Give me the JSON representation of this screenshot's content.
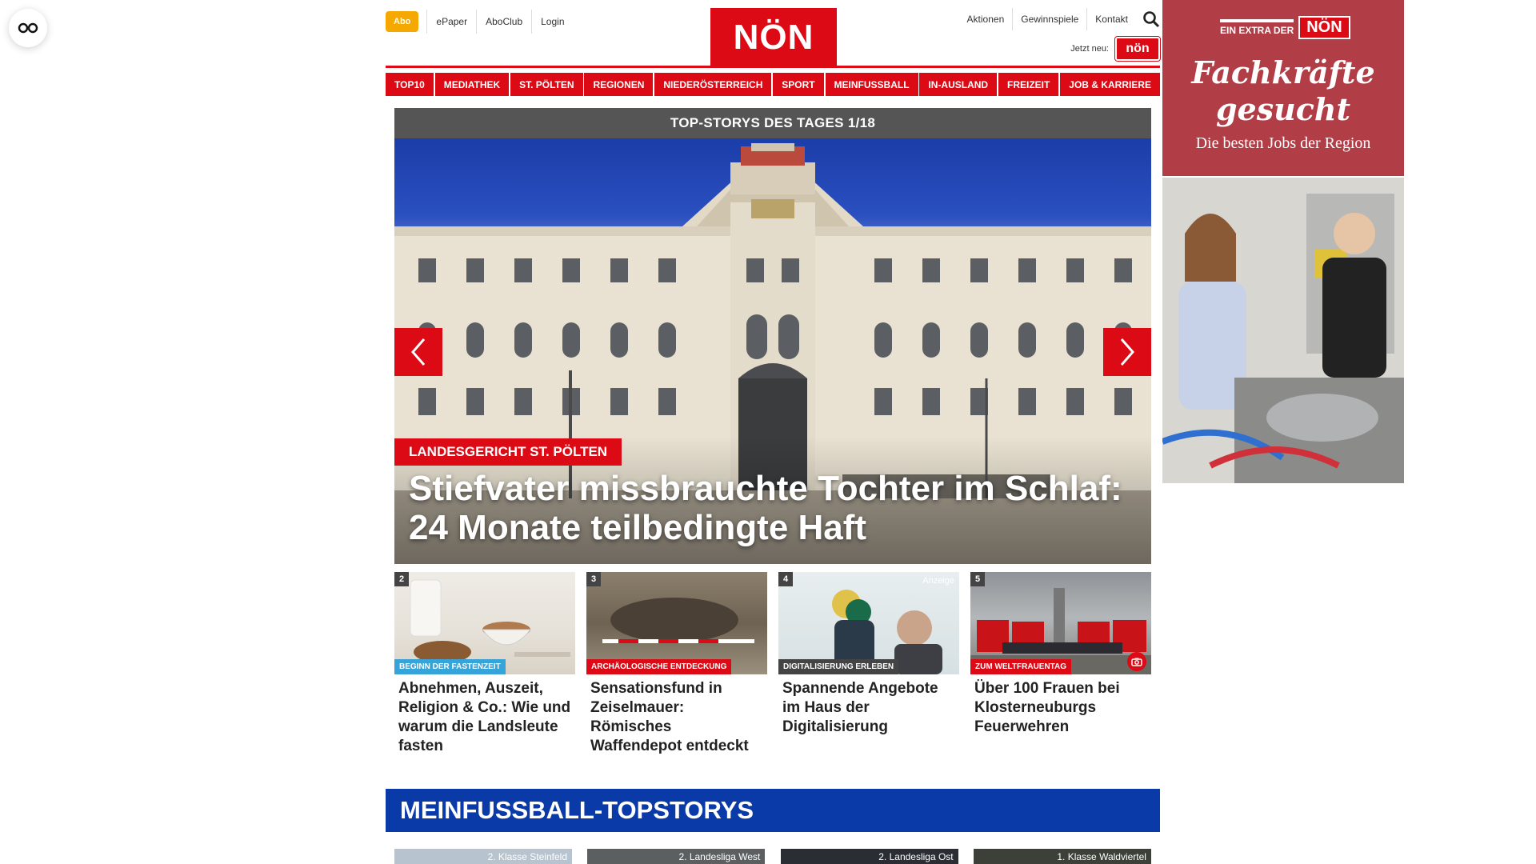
{
  "reader_button": {
    "icon": "glasses-icon"
  },
  "header": {
    "abo": "Abo",
    "links_left": [
      "ePaper",
      "AboClub",
      "Login"
    ],
    "logo": "NÖN",
    "links_right": [
      "Aktionen",
      "Gewinnspiele",
      "Kontakt"
    ],
    "search_icon": "search-icon",
    "jetzt_neu": "Jetzt neu:",
    "jetzt_badge": "nön"
  },
  "nav": [
    "TOP10",
    "MEDIATHEK",
    "ST. PÖLTEN",
    "REGIONEN",
    "NIEDERÖSTERREICH",
    "SPORT",
    "MEINFUSSBALL",
    "IN-AUSLAND",
    "FREIZEIT",
    "JOB & KARRIERE"
  ],
  "hero": {
    "bar_title": "TOP-STORYS DES TAGES 1/18",
    "tag": "LANDESGERICHT ST. PÖLTEN",
    "title": "Stiefvater missbrauchte Tochter im Schlaf: 24 Monate teilbedingte Haft",
    "prev_icon": "chevron-left-icon",
    "next_icon": "chevron-right-icon"
  },
  "stories": [
    {
      "num": "2",
      "tag": "BEGINN DER FASTENZEIT",
      "tag_color": "#36a3d9",
      "title": "Abnehmen, Auszeit, Religion & Co.: Wie und warum die Landsleute fasten"
    },
    {
      "num": "3",
      "tag": "ARCHÄOLOGISCHE ENTDECKUNG",
      "tag_color": "#dc0a14",
      "title": "Sensationsfund in Zeiselmauer: Römisches Waffendepot entdeckt"
    },
    {
      "num": "4",
      "tag": "DIGITALISIERUNG ERLEBEN",
      "tag_color": "#444444",
      "title": "Spannende Angebote im Haus der Digitalisierung",
      "anzeige": "Anzeige"
    },
    {
      "num": "5",
      "tag": "ZUM WELTFRAUENTAG",
      "tag_color": "#dc0a14",
      "title": "Über 100 Frauen bei Klosterneuburgs Feuerwehren",
      "camera_icon": "camera-icon"
    }
  ],
  "meinfussball": {
    "title": "MEINFUSSBALL-TOPSTORYS",
    "cards": [
      "2. Klasse Steinfeld",
      "2. Landesliga West",
      "2. Landesliga Ost",
      "1. Klasse Waldviertel"
    ]
  },
  "ad": {
    "extra_label": "EIN EXTRA DER",
    "extra_logo": "NÖN",
    "headline_1": "Fachkräfte",
    "headline_2": "gesucht",
    "sub": "Die besten Jobs der Region"
  },
  "colors": {
    "brand_red": "#dc0a14",
    "abo_orange": "#f5a800",
    "fussball_blue": "#0a3aa8",
    "ad_red": "#b13d46"
  }
}
